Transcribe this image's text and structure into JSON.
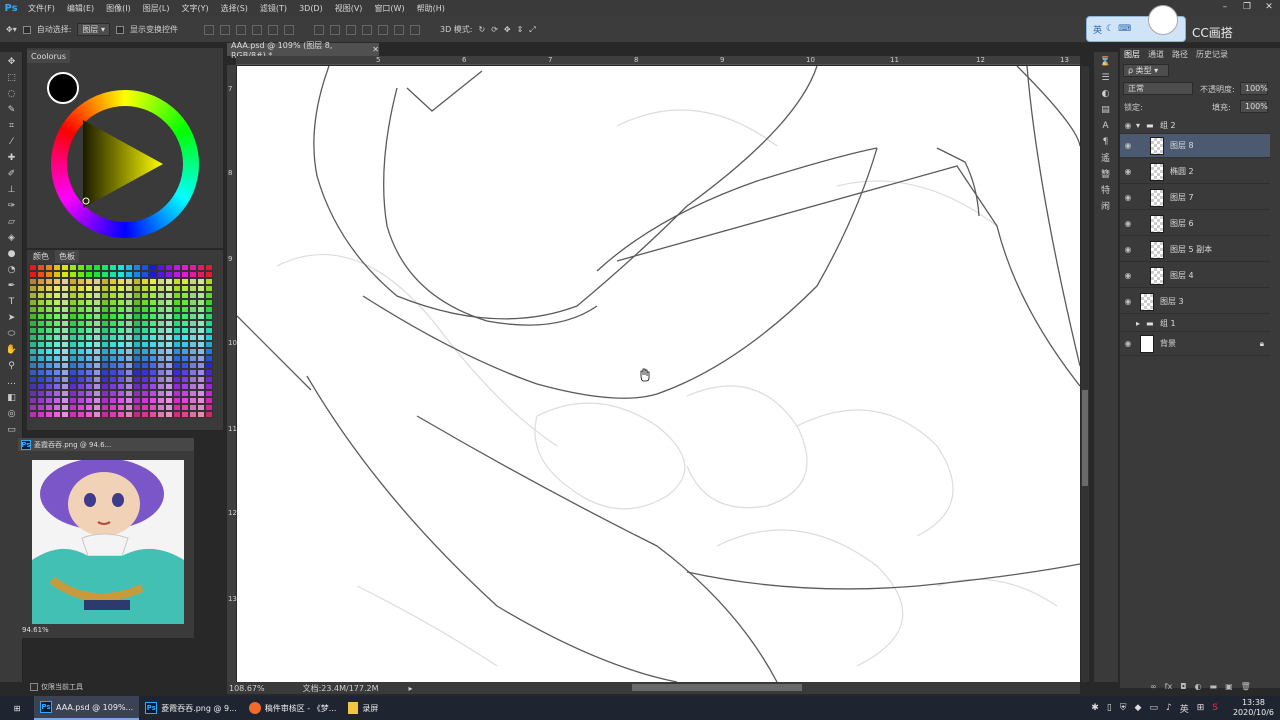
{
  "app": {
    "logo": "Ps",
    "menu": [
      "文件(F)",
      "编辑(E)",
      "图像(I)",
      "图层(L)",
      "文字(Y)",
      "选择(S)",
      "滤镜(T)",
      "3D(D)",
      "视图(V)",
      "窗口(W)",
      "帮助(H)"
    ]
  },
  "options_bar": {
    "auto_select_label": "自动选择:",
    "auto_select_value": "图层",
    "show_transform_label": "显示变换控件",
    "mode_3d_label": "3D 模式:"
  },
  "ime": {
    "label": "英",
    "cc_brand": "CC画搭"
  },
  "document": {
    "tab_title": "AAA.psd @ 109% (图层 8, RGB/8#) *",
    "ruler_top": [
      "5",
      "6",
      "7",
      "8",
      "9",
      "10",
      "11",
      "12",
      "13"
    ],
    "ruler_left": [
      "7",
      "8",
      "9",
      "10",
      "11",
      "12",
      "13"
    ],
    "zoom_status": "108.67%",
    "doc_size": "文档:23.4M/177.2M"
  },
  "coolorus": {
    "tab": "Coolorus"
  },
  "swatches": {
    "tabs": [
      "颜色",
      "色板"
    ]
  },
  "preview": {
    "title": "菱霞吞吞.png @ 94.6...",
    "zoom": "94.61%"
  },
  "bottom_left": {
    "label": "仅限当前工具"
  },
  "layers_panel": {
    "tabs": [
      "图层",
      "通道",
      "路径",
      "历史记录"
    ],
    "filter_label": "ρ 类型",
    "blend_mode": "正常",
    "opacity_label": "不透明度:",
    "opacity_value": "100%",
    "lock_label": "锁定:",
    "fill_label": "填充:",
    "fill_value": "100%",
    "layers": [
      {
        "name": "组 2",
        "type": "group-open"
      },
      {
        "name": "图层 8",
        "type": "layer",
        "selected": true
      },
      {
        "name": "椭圆 2",
        "type": "layer"
      },
      {
        "name": "图层 7",
        "type": "layer"
      },
      {
        "name": "图层 6",
        "type": "layer"
      },
      {
        "name": "图层 5 副本",
        "type": "layer"
      },
      {
        "name": "图层 4",
        "type": "layer"
      },
      {
        "name": "图层 3",
        "type": "layer"
      },
      {
        "name": "组 1",
        "type": "group-closed"
      },
      {
        "name": "背景",
        "type": "background"
      }
    ]
  },
  "taskbar": {
    "items": [
      {
        "label": "AAA.psd @ 109%...",
        "active": true
      },
      {
        "label": "菱霞吞吞.png @ 9...",
        "active": false
      },
      {
        "label": "稿件审核区 - 《梦...",
        "active": false
      },
      {
        "label": "录屏",
        "active": false
      }
    ],
    "tray_lang": "英",
    "time": "13:38",
    "date": "2020/10/6"
  },
  "colors": {
    "accent": "#31a8ff",
    "selected_layer": "#4b5a70",
    "canvas": "#ffffff"
  }
}
